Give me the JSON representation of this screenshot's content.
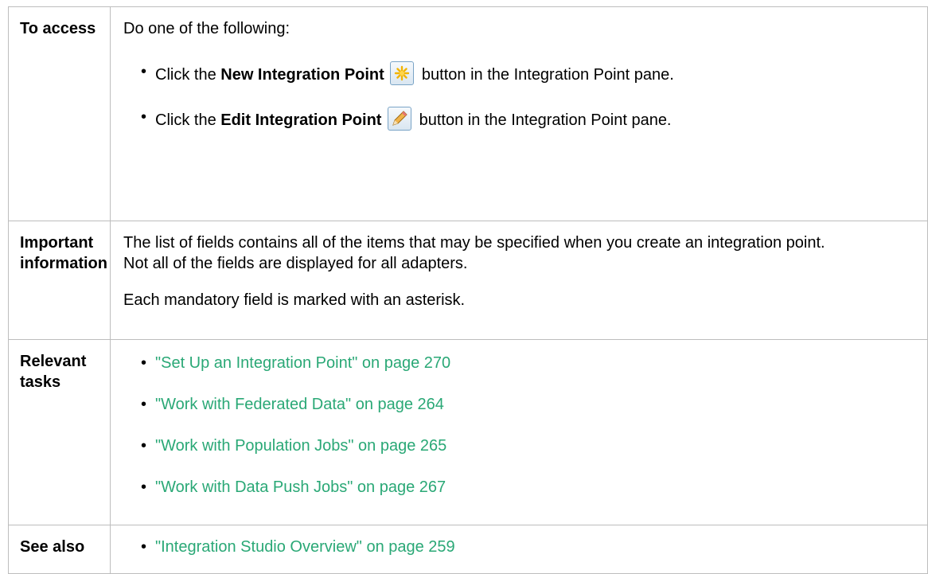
{
  "rows": [
    {
      "label": "To access",
      "intro": "Do one of the following:",
      "items": [
        {
          "pre": "Click the ",
          "bold": "New Integration Point",
          "icon": "new-integration-point-icon",
          "post": " button in the Integration Point pane."
        },
        {
          "pre": "Click the ",
          "bold": "Edit Integration Point",
          "icon": "edit-pencil-icon",
          "post": " button in the Integration Point pane."
        }
      ]
    },
    {
      "label": "Important information",
      "paragraphs": [
        "The list of fields contains all of the items that may be specified when you create an integration point. Not all of the fields are displayed for all adapters.",
        "Each mandatory field is marked with an asterisk."
      ]
    },
    {
      "label": "Relevant tasks",
      "links": [
        "\"Set Up an Integration Point\" on page 270",
        "\"Work with Federated Data\" on page 264",
        "\"Work with Population Jobs\" on page 265",
        "\"Work with Data Push Jobs\" on page 267"
      ]
    },
    {
      "label": "See also",
      "links": [
        "\"Integration Studio Overview\" on page 259"
      ]
    }
  ],
  "colors": {
    "link": "#2aa876",
    "border": "#bdbdbd"
  }
}
